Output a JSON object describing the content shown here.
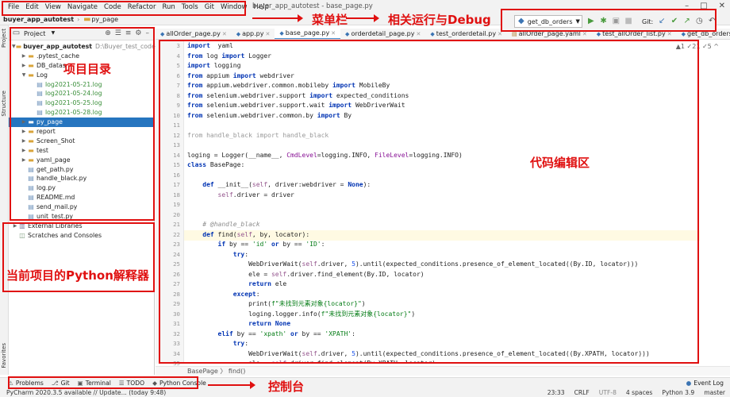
{
  "window": {
    "title": "buyer_app_autotest - base_page.py"
  },
  "menu": [
    "File",
    "Edit",
    "View",
    "Navigate",
    "Code",
    "Refactor",
    "Run",
    "Tools",
    "Git",
    "Window",
    "Help"
  ],
  "navbar": {
    "project": "buyer_app_autotest",
    "folder": "py_page"
  },
  "run": {
    "config": "get_db_orders",
    "git_label": "Git:"
  },
  "project_panel": {
    "title": "Project",
    "items": [
      {
        "label": "buyer_app_autotest",
        "extra": "D:\\Buyer_test_code\\bu",
        "indent": 0,
        "arrow": "open",
        "icon": "folder"
      },
      {
        "label": ".pytest_cache",
        "indent": 1,
        "arrow": "closed",
        "icon": "folder"
      },
      {
        "label": "DB_datas",
        "indent": 1,
        "arrow": "closed",
        "icon": "folder"
      },
      {
        "label": "Log",
        "indent": 1,
        "arrow": "open",
        "icon": "folder"
      },
      {
        "label": "log2021-05-21.log",
        "indent": 2,
        "icon": "file",
        "style": "green"
      },
      {
        "label": "log2021-05-24.log",
        "indent": 2,
        "icon": "file",
        "style": "green"
      },
      {
        "label": "log2021-05-25.log",
        "indent": 2,
        "icon": "file",
        "style": "green"
      },
      {
        "label": "log2021-05-28.log",
        "indent": 2,
        "icon": "file",
        "style": "green"
      },
      {
        "label": "py_page",
        "indent": 1,
        "arrow": "closed",
        "icon": "folder",
        "style": "sel"
      },
      {
        "label": "report",
        "indent": 1,
        "arrow": "closed",
        "icon": "folder"
      },
      {
        "label": "Screen_Shot",
        "indent": 1,
        "arrow": "closed",
        "icon": "folder"
      },
      {
        "label": "test",
        "indent": 1,
        "arrow": "closed",
        "icon": "folder"
      },
      {
        "label": "yaml_page",
        "indent": 1,
        "arrow": "closed",
        "icon": "folder"
      },
      {
        "label": "get_path.py",
        "indent": 1,
        "icon": "file"
      },
      {
        "label": "handle_black.py",
        "indent": 1,
        "icon": "file"
      },
      {
        "label": "log.py",
        "indent": 1,
        "icon": "file"
      },
      {
        "label": "README.md",
        "indent": 1,
        "icon": "file"
      },
      {
        "label": "send_mail.py",
        "indent": 1,
        "icon": "file"
      },
      {
        "label": "unit_test.py",
        "indent": 1,
        "icon": "file"
      },
      {
        "label": "External Libraries",
        "indent": 0,
        "arrow": "closed",
        "icon": "lib"
      },
      {
        "label": "Scratches and Consoles",
        "indent": 0,
        "icon": "scratch"
      }
    ]
  },
  "tabs": [
    "allOrder_page.py",
    "app.py",
    "base_page.py",
    "orderdetail_page.py",
    "test_orderdetail.py",
    "allOrder_page.yaml",
    "test_allOrder_list.py",
    "get_db_orders.py"
  ],
  "active_tab": 2,
  "editor": {
    "line_numbers": [
      "3",
      "4",
      "5",
      "6",
      "7",
      "8",
      "9",
      "10",
      "11",
      "12",
      "13",
      "14",
      "15",
      "16",
      "17",
      "18",
      "19",
      "20",
      "21",
      "22",
      "23",
      "24",
      "25",
      "26",
      "27",
      "28",
      "29",
      "30",
      "31",
      "32",
      "33",
      "34",
      "35",
      "36",
      "37"
    ],
    "lines": [
      [
        [
          "kw",
          "import"
        ],
        [
          "",
          "  yaml"
        ]
      ],
      [
        [
          "kw",
          "from"
        ],
        [
          "",
          " log "
        ],
        [
          "kw",
          "import"
        ],
        [
          "",
          " Logger"
        ]
      ],
      [
        [
          "kw",
          "import"
        ],
        [
          "",
          " logging"
        ]
      ],
      [
        [
          "kw",
          "from"
        ],
        [
          "",
          " appium "
        ],
        [
          "kw",
          "import"
        ],
        [
          "",
          " webdriver"
        ]
      ],
      [
        [
          "kw",
          "from"
        ],
        [
          "",
          " appium.webdriver.common.mobileby "
        ],
        [
          "kw",
          "import"
        ],
        [
          "",
          " MobileBy"
        ]
      ],
      [
        [
          "kw",
          "from"
        ],
        [
          "",
          " selenium.webdriver.support "
        ],
        [
          "kw",
          "import"
        ],
        [
          "",
          " expected_conditions"
        ]
      ],
      [
        [
          "kw",
          "from"
        ],
        [
          "",
          " selenium.webdriver.support.wait "
        ],
        [
          "kw",
          "import"
        ],
        [
          "",
          " WebDriverWait"
        ]
      ],
      [
        [
          "kw",
          "from"
        ],
        [
          "",
          " selenium.webdriver.common.by "
        ],
        [
          "kw",
          "import"
        ],
        [
          "",
          " By"
        ]
      ],
      [],
      [
        [
          "faded",
          "from handle_black import handle_black"
        ]
      ],
      [],
      [
        [
          "",
          "loging = Logger(__name__, "
        ],
        [
          "par",
          "CmdLevel"
        ],
        [
          "",
          "=logging.INFO, "
        ],
        [
          "par",
          "FileLevel"
        ],
        [
          "",
          "=logging.INFO)"
        ]
      ],
      [
        [
          "kw",
          "class"
        ],
        [
          "",
          " BasePage:"
        ]
      ],
      [],
      [
        [
          "",
          "    "
        ],
        [
          "kw",
          "def"
        ],
        [
          "",
          " __init__("
        ],
        [
          "self",
          "self"
        ],
        [
          "",
          ", driver:webdriver = "
        ],
        [
          "kw",
          "None"
        ],
        [
          "",
          "):"
        ]
      ],
      [
        [
          "",
          "        "
        ],
        [
          "self",
          "self"
        ],
        [
          "",
          ".driver = driver"
        ]
      ],
      [],
      [],
      [
        [
          "cm",
          "    # @handle_black"
        ]
      ],
      [
        [
          "",
          "    "
        ],
        [
          "kw",
          "def"
        ],
        [
          "",
          " find("
        ],
        [
          "self",
          "self"
        ],
        [
          "",
          ", by, locator):"
        ]
      ],
      [
        [
          "",
          "        "
        ],
        [
          "kw",
          "if"
        ],
        [
          "",
          " by == "
        ],
        [
          "str",
          "'id'"
        ],
        [
          "kw",
          " or"
        ],
        [
          "",
          " by == "
        ],
        [
          "str",
          "'ID'"
        ],
        [
          "",
          ":"
        ]
      ],
      [
        [
          "",
          "            "
        ],
        [
          "kw",
          "try"
        ],
        [
          "",
          ":"
        ]
      ],
      [
        [
          "",
          "                WebDriverWait("
        ],
        [
          "self",
          "self"
        ],
        [
          "",
          ".driver, "
        ],
        [
          "num",
          "5"
        ],
        [
          "",
          ").until(expected_conditions.presence_of_element_located((By.ID, locator)))"
        ]
      ],
      [
        [
          "",
          "                ele = "
        ],
        [
          "self",
          "self"
        ],
        [
          "",
          ".driver.find_element(By.ID, locator)"
        ]
      ],
      [
        [
          "",
          "                "
        ],
        [
          "kw",
          "return"
        ],
        [
          "",
          " ele"
        ]
      ],
      [
        [
          "",
          "            "
        ],
        [
          "kw",
          "except"
        ],
        [
          "",
          ":"
        ]
      ],
      [
        [
          "",
          "                print("
        ],
        [
          "str",
          "f\"未找到元素对象{locator}\""
        ],
        [
          "",
          ")"
        ]
      ],
      [
        [
          "",
          "                loging.logger.info("
        ],
        [
          "str",
          "f\"未找到元素对象{locator}\""
        ],
        [
          "",
          ")"
        ]
      ],
      [
        [
          "",
          "                "
        ],
        [
          "kw",
          "return"
        ],
        [
          "",
          " "
        ],
        [
          "kw",
          "None"
        ]
      ],
      [
        [
          "",
          "        "
        ],
        [
          "kw",
          "elif"
        ],
        [
          "",
          " by == "
        ],
        [
          "str",
          "'xpath'"
        ],
        [
          "kw",
          " or"
        ],
        [
          "",
          " by == "
        ],
        [
          "str",
          "'XPATH'"
        ],
        [
          "",
          ":"
        ]
      ],
      [
        [
          "",
          "            "
        ],
        [
          "kw",
          "try"
        ],
        [
          "",
          ":"
        ]
      ],
      [
        [
          "",
          "                WebDriverWait("
        ],
        [
          "self",
          "self"
        ],
        [
          "",
          ".driver, "
        ],
        [
          "num",
          "5"
        ],
        [
          "",
          ").until(expected_conditions.presence_of_element_located((By.XPATH, locator)))"
        ]
      ],
      [
        [
          "",
          "                ele = "
        ],
        [
          "self",
          "self"
        ],
        [
          "",
          ".driver.find_element(By.XPATH, locator)"
        ]
      ]
    ],
    "indicators": "▲1  ✓21  ✓5  ^",
    "breadcrumb": "BasePage  〉 find()"
  },
  "toolwindows": [
    "Problems",
    "Git",
    "Terminal",
    "TODO",
    "Python Console"
  ],
  "statusbar": {
    "message": "PyCharm 2020.3.5 available // Update... (today 9:48)",
    "pos": "23:33",
    "crlf": "CRLF",
    "enc": "UTF-8",
    "indent": "4 spaces",
    "py": "Python 3.9",
    "branch": "master"
  },
  "event_log": "Event Log",
  "annotations": {
    "menubar": "菜单栏",
    "run": "相关运行与Debug",
    "project": "项目目录",
    "editor": "代码编辑区",
    "interpreter": "当前项目的Python解释器",
    "console": "控制台"
  },
  "side_tabs": {
    "project": "Project",
    "structure": "Structure",
    "favorites": "Favorites"
  }
}
